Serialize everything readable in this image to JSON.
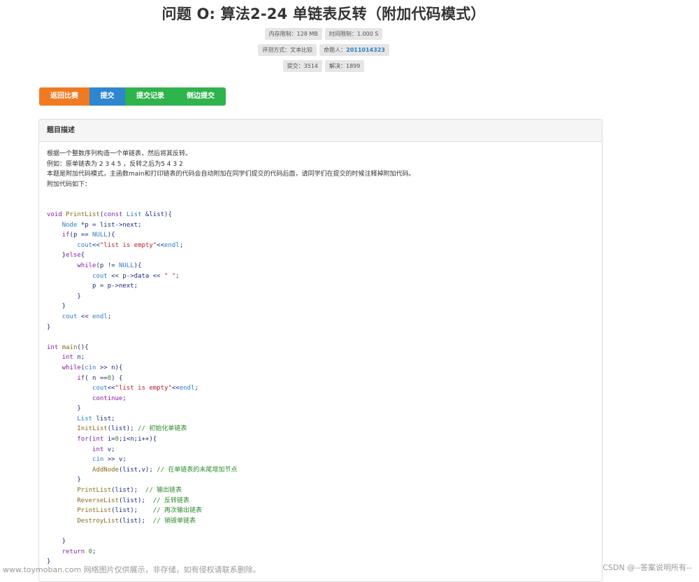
{
  "title": "问题 O: 算法2-24 单链表反转（附加代码模式）",
  "info": {
    "row1": [
      "内存限制：128 MB",
      "时间限制：1.000 S"
    ],
    "judge": "评测方式：文本比较",
    "author_label": "命题人：",
    "author_value": "2011014323",
    "row3": [
      "提交：3514",
      "解决：1899"
    ]
  },
  "buttons": {
    "back": "返回比赛",
    "submit": "提交",
    "records": "提交记录",
    "discuss": "侧边提交"
  },
  "panel": {
    "heading": "题目描述",
    "desc_lines": [
      "根据一个整数序列构造一个单链表，然后将其反转。",
      "例如：原单链表为 2 3 4 5 ，反转之后为5 4 3 2",
      "本题是附加代码模式，主函数main和打印链表的代码会自动附加在同学们提交的代码后面，请同学们在提交的时候注释掉附加代码。",
      "附加代码如下："
    ]
  },
  "code_lines": [
    "void PrintList(const List &list){",
    "    Node *p = list->next;",
    "    if(p == NULL){",
    "        cout<<\"list is empty\"<<endl;",
    "    }else{",
    "        while(p != NULL){",
    "            cout << p->data << \" \";",
    "            p = p->next;",
    "        }",
    "    }",
    "    cout << endl;",
    "}",
    "",
    "int main(){",
    "    int n;",
    "    while(cin >> n){",
    "        if( n ==0) {",
    "            cout<<\"list is empty\"<<endl;",
    "            continue;",
    "        }",
    "        List list;",
    "        InitList(list); // 初始化单链表",
    "        for(int i=0;i<n;i++){",
    "            int v;",
    "            cin >> v;",
    "            AddNode(list,v); // 在单链表的末尾增加节点",
    "        }",
    "        PrintList(list);  // 输出链表",
    "        ReverseList(list);  // 反转链表",
    "        PrintList(list);    // 再次输出链表",
    "        DestroyList(list);  // 销毁单链表",
    "",
    "    }",
    "    return 0;",
    "}"
  ],
  "watermark_left": "www.toymoban.com 网络图片仅供展示，非存储，如有侵权请联系删除。",
  "watermark_right": "CSDN @--答案说明所有--"
}
